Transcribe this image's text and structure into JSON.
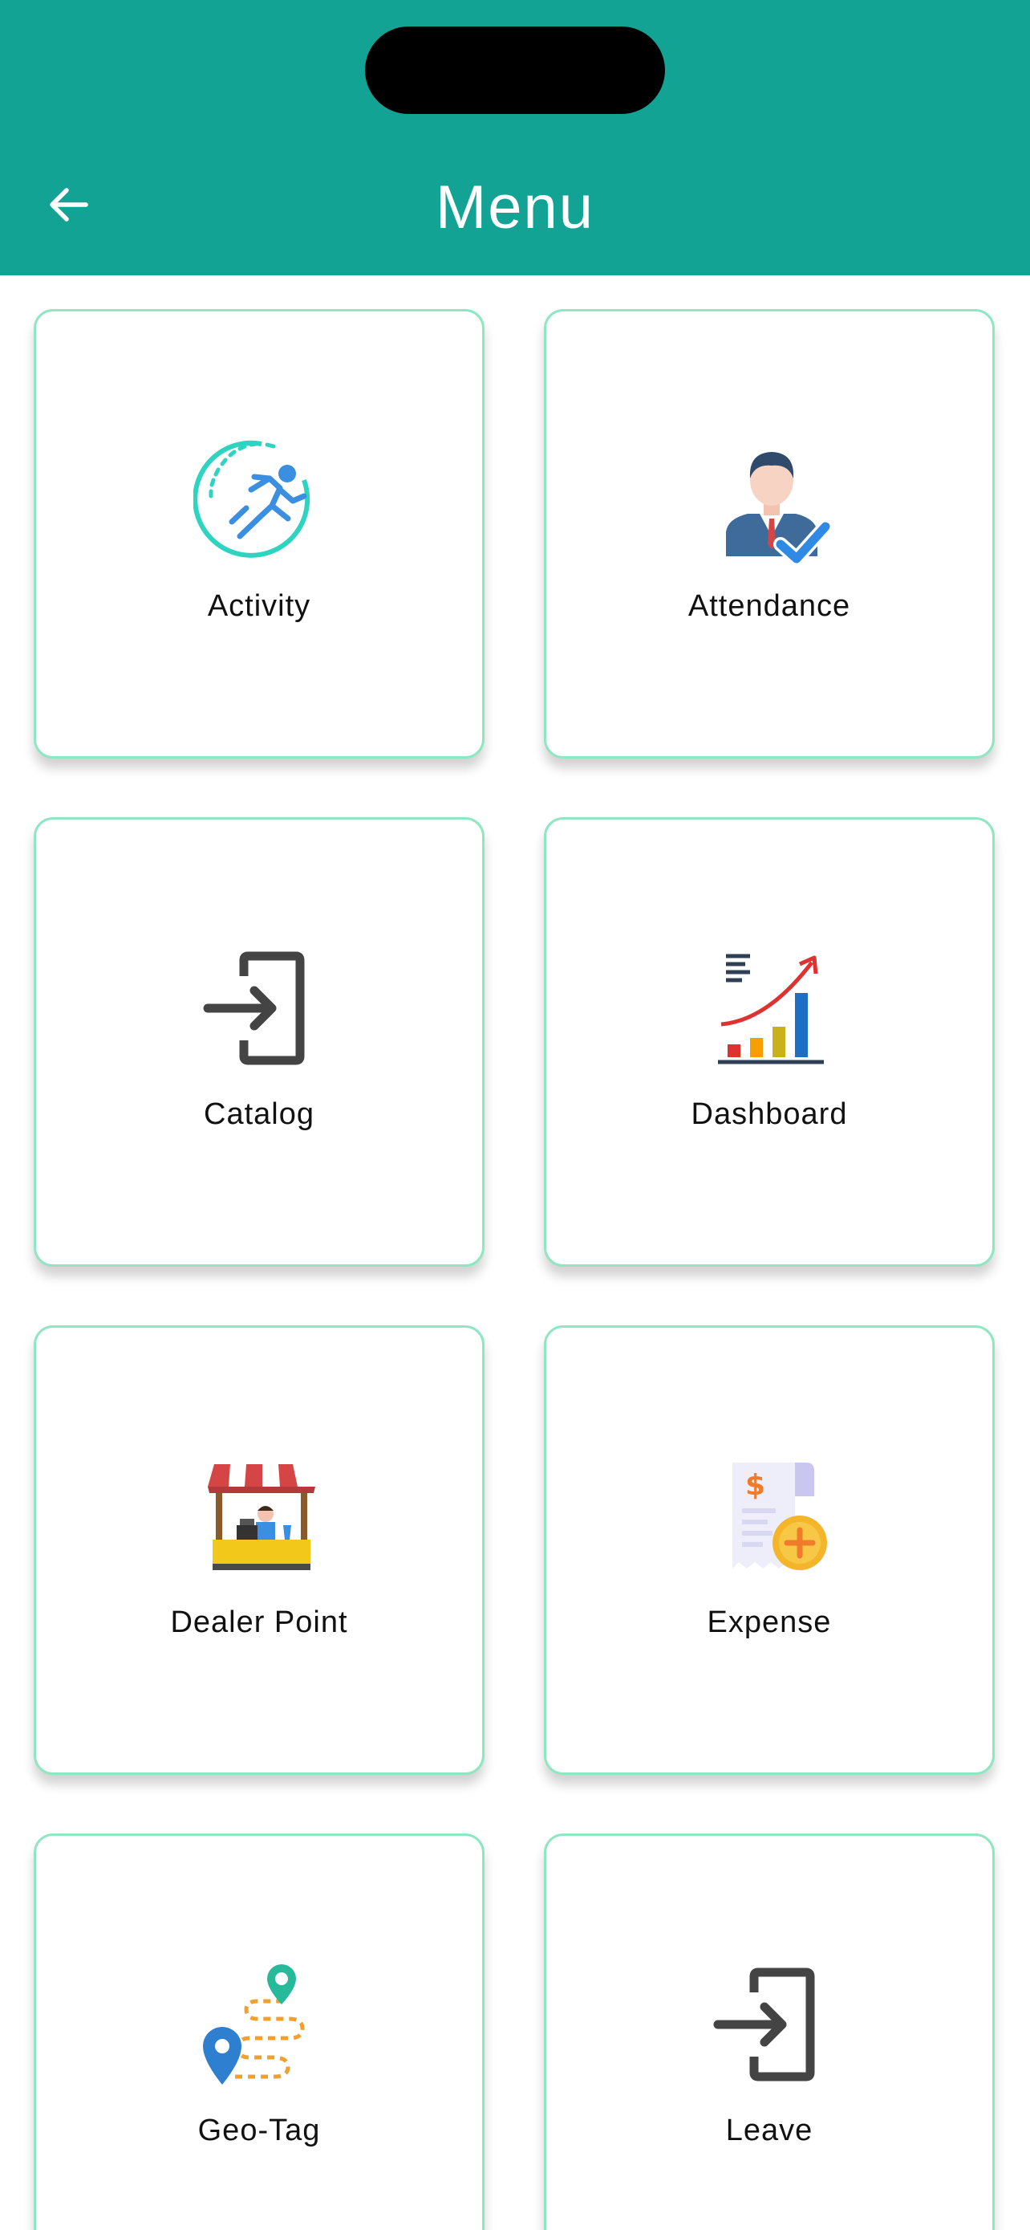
{
  "header": {
    "title": "Menu",
    "back_icon": "arrow-left-icon",
    "background_color": "#13a394"
  },
  "menu": {
    "items": [
      {
        "label": "Activity",
        "icon": "running-person-icon"
      },
      {
        "label": "Attendance",
        "icon": "employee-check-icon"
      },
      {
        "label": "Catalog",
        "icon": "login-arrow-icon"
      },
      {
        "label": "Dashboard",
        "icon": "growth-chart-icon"
      },
      {
        "label": "Dealer Point",
        "icon": "market-stall-icon"
      },
      {
        "label": "Expense",
        "icon": "receipt-add-icon"
      },
      {
        "label": "Geo-Tag",
        "icon": "map-route-icon"
      },
      {
        "label": "Leave",
        "icon": "login-arrow-icon"
      }
    ],
    "card_border_color": "#8ee7c2"
  }
}
